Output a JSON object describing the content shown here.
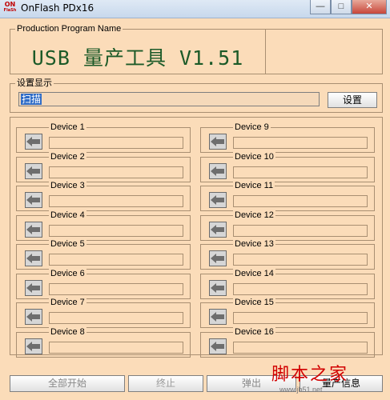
{
  "window": {
    "logo_top": "ON",
    "logo_bottom": "FlaSh",
    "title": "OnFlash PDx16",
    "minimize_glyph": "—",
    "maximize_glyph": "□",
    "close_glyph": "✕"
  },
  "production": {
    "group_label": "Production Program Name",
    "program_name": "USB 量产工具 V1.51"
  },
  "settings": {
    "group_label": "设置显示",
    "path_value": "扫描",
    "settings_button": "设置"
  },
  "devices": [
    {
      "label": "Device 1",
      "value": ""
    },
    {
      "label": "Device 2",
      "value": ""
    },
    {
      "label": "Device 3",
      "value": ""
    },
    {
      "label": "Device 4",
      "value": ""
    },
    {
      "label": "Device 5",
      "value": ""
    },
    {
      "label": "Device 6",
      "value": ""
    },
    {
      "label": "Device 7",
      "value": ""
    },
    {
      "label": "Device 8",
      "value": ""
    },
    {
      "label": "Device 9",
      "value": ""
    },
    {
      "label": "Device 10",
      "value": ""
    },
    {
      "label": "Device 11",
      "value": ""
    },
    {
      "label": "Device 12",
      "value": ""
    },
    {
      "label": "Device 13",
      "value": ""
    },
    {
      "label": "Device 14",
      "value": ""
    },
    {
      "label": "Device 15",
      "value": ""
    },
    {
      "label": "Device 16",
      "value": ""
    }
  ],
  "bottom": {
    "start_all": "全部开始",
    "stop": "终止",
    "eject": "弹出",
    "info": "量产信息"
  },
  "watermark": {
    "title": "脚本之家",
    "url": "www.jb51.net"
  },
  "colors": {
    "background": "#fbdcb9",
    "program_name": "#1c5a28",
    "selection": "#2f6cc7",
    "watermark": "#d20000"
  }
}
